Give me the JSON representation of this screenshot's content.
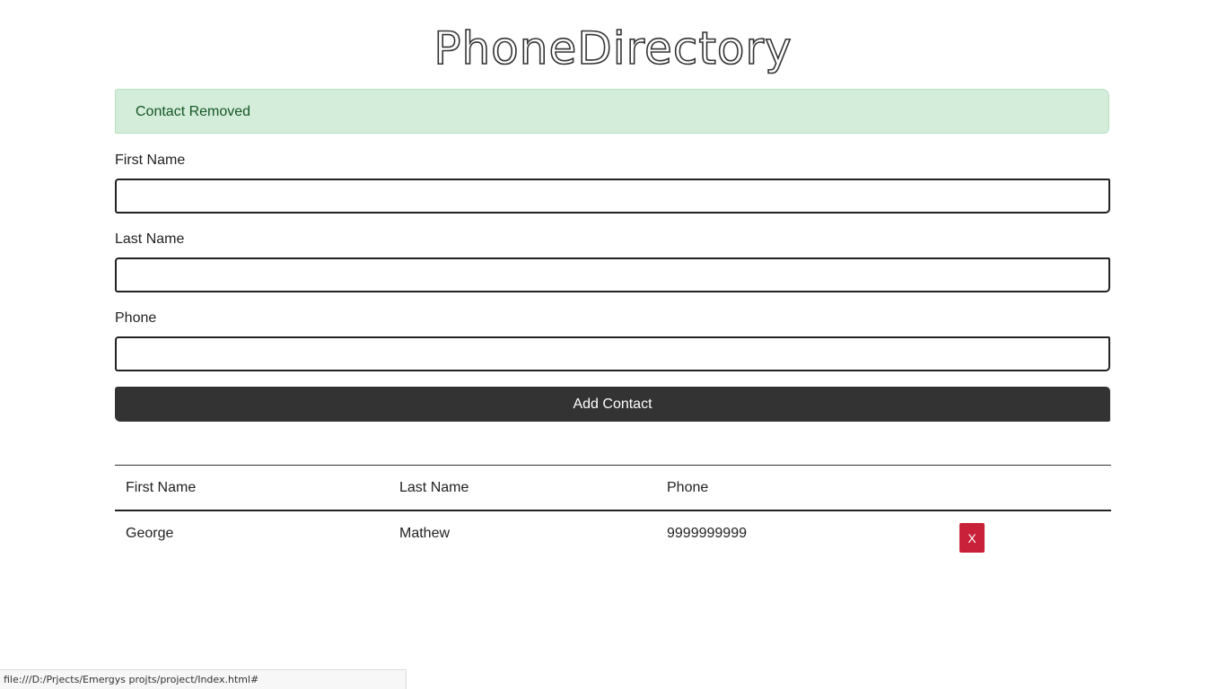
{
  "title": "PhoneDirectory",
  "alert": {
    "message": "Contact Removed"
  },
  "form": {
    "first_name_label": "First Name",
    "first_name_value": "",
    "last_name_label": "Last Name",
    "last_name_value": "",
    "phone_label": "Phone",
    "phone_value": "",
    "add_button_label": "Add Contact"
  },
  "table": {
    "headers": [
      "First Name",
      "Last Name",
      "Phone",
      ""
    ],
    "rows": [
      {
        "first_name": "George",
        "last_name": "Mathew",
        "phone": "9999999999",
        "delete_label": "X"
      }
    ]
  },
  "status_bar": {
    "url": "file:///D:/Prjects/Emergys projts/project/Index.html#"
  },
  "colors": {
    "alert_bg": "#d4edda",
    "alert_text": "#155724",
    "button_dark": "#333333",
    "delete_red": "#c9213a"
  }
}
